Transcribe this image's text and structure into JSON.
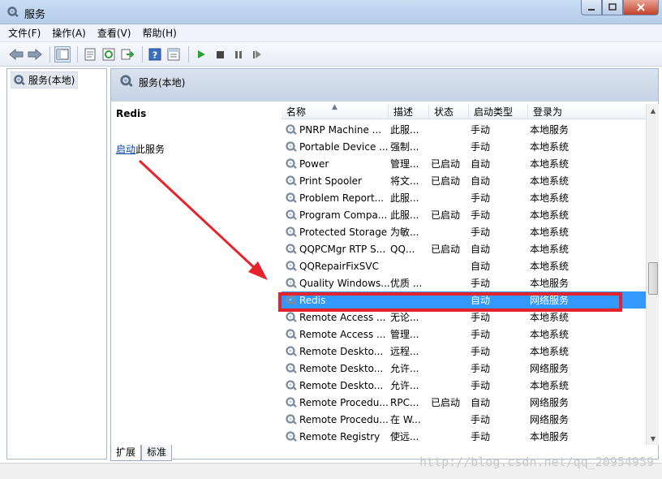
{
  "window": {
    "title": "服务"
  },
  "menu": [
    "文件(F)",
    "操作(A)",
    "查看(V)",
    "帮助(H)"
  ],
  "toolbar_icons": [
    "back-arrow-icon",
    "forward-arrow-icon",
    "console-tree-icon",
    "properties-icon",
    "refresh-icon",
    "export-icon",
    "help-icon",
    "show-hide-icon",
    "start-icon",
    "stop-icon",
    "pause-icon",
    "restart-icon"
  ],
  "tree": {
    "root": "服务(本地)"
  },
  "main": {
    "header": "服务(本地)"
  },
  "desc": {
    "service_name": "Redis",
    "start_link": "启动",
    "start_suffix": "此服务"
  },
  "columns": [
    "名称",
    "描述",
    "状态",
    "启动类型",
    "登录为"
  ],
  "rows": [
    {
      "name": "PNRP Machine ...",
      "desc": "此服...",
      "status": "",
      "start": "手动",
      "logon": "本地服务"
    },
    {
      "name": "Portable Device ...",
      "desc": "强制...",
      "status": "",
      "start": "手动",
      "logon": "本地系统"
    },
    {
      "name": "Power",
      "desc": "管理...",
      "status": "已启动",
      "start": "自动",
      "logon": "本地系统"
    },
    {
      "name": "Print Spooler",
      "desc": "将文...",
      "status": "已启动",
      "start": "自动",
      "logon": "本地系统"
    },
    {
      "name": "Problem Report...",
      "desc": "此服...",
      "status": "",
      "start": "手动",
      "logon": "本地系统"
    },
    {
      "name": "Program Compa...",
      "desc": "此服...",
      "status": "已启动",
      "start": "手动",
      "logon": "本地系统"
    },
    {
      "name": "Protected Storage",
      "desc": "为敏...",
      "status": "",
      "start": "手动",
      "logon": "本地系统"
    },
    {
      "name": "QQPCMgr RTP S...",
      "desc": "QQ...",
      "status": "已启动",
      "start": "自动",
      "logon": "本地系统"
    },
    {
      "name": "QQRepairFixSVC",
      "desc": "",
      "status": "",
      "start": "自动",
      "logon": "本地系统"
    },
    {
      "name": "Quality Windows...",
      "desc": "优质 ...",
      "status": "",
      "start": "手动",
      "logon": "本地服务"
    },
    {
      "name": "Redis",
      "desc": "",
      "status": "",
      "start": "自动",
      "logon": "网络服务"
    },
    {
      "name": "Remote Access ...",
      "desc": "无论...",
      "status": "",
      "start": "手动",
      "logon": "本地系统"
    },
    {
      "name": "Remote Access ...",
      "desc": "管理...",
      "status": "",
      "start": "手动",
      "logon": "本地系统"
    },
    {
      "name": "Remote Deskto...",
      "desc": "远程...",
      "status": "",
      "start": "手动",
      "logon": "本地系统"
    },
    {
      "name": "Remote Deskto...",
      "desc": "允许...",
      "status": "",
      "start": "手动",
      "logon": "网络服务"
    },
    {
      "name": "Remote Deskto...",
      "desc": "允许...",
      "status": "",
      "start": "手动",
      "logon": "本地系统"
    },
    {
      "name": "Remote Procedu...",
      "desc": "RPC...",
      "status": "已启动",
      "start": "自动",
      "logon": "网络服务"
    },
    {
      "name": "Remote Procedu...",
      "desc": "在 W...",
      "status": "",
      "start": "手动",
      "logon": "网络服务"
    },
    {
      "name": "Remote Registry",
      "desc": "使远...",
      "status": "",
      "start": "手动",
      "logon": "本地服务"
    }
  ],
  "selected_index": 10,
  "tabs": [
    "扩展",
    "标准"
  ],
  "watermark": "http://blog.csdn.net/qq_20954959",
  "colors": {
    "selection": "#3399ff",
    "highlight": "#e6222d",
    "link": "#0645ad"
  }
}
